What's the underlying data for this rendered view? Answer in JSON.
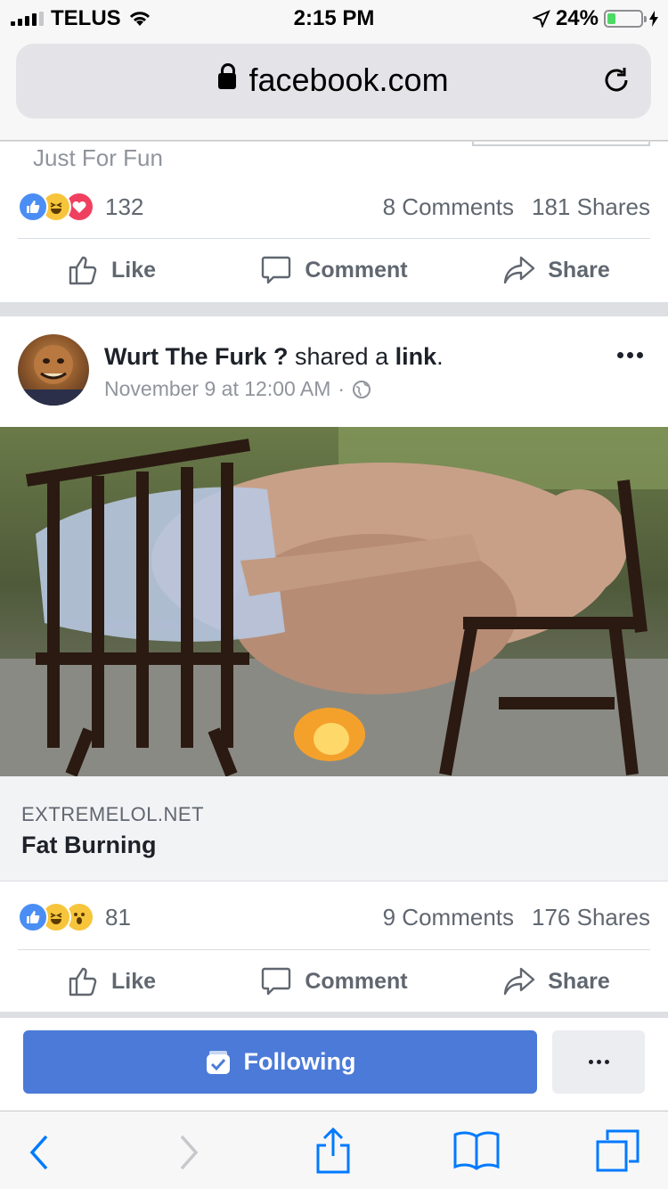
{
  "status": {
    "carrier": "TELUS",
    "time": "2:15 PM",
    "battery": "24%",
    "battery_level": 0.24
  },
  "browser": {
    "url": "facebook.com"
  },
  "post1": {
    "subtitle": "Just For Fun",
    "reaction_count": "132",
    "comments": "8 Comments",
    "shares": "181 Shares",
    "reactions": [
      "like-icon",
      "haha-icon",
      "love-icon"
    ],
    "actions": {
      "like": "Like",
      "comment": "Comment",
      "share": "Share"
    }
  },
  "post2": {
    "poster": "Wurt The Furk ?",
    "action_text": "shared a",
    "link_word": "link",
    "period": ".",
    "timestamp": "November 9 at 12:00 AM",
    "separator": "·",
    "link_domain": "EXTREMELOL.NET",
    "link_title": "Fat Burning",
    "reaction_count": "81",
    "comments": "9 Comments",
    "shares": "176 Shares",
    "reactions": [
      "like-icon",
      "haha-icon",
      "wow-icon"
    ],
    "actions": {
      "like": "Like",
      "comment": "Comment",
      "share": "Share"
    }
  },
  "follow": {
    "label": "Following"
  },
  "colors": {
    "brand": "#4b7ad8",
    "like": "#4a8ef5",
    "love": "#f0405f",
    "haha": "#f7c53b",
    "battery": "#4cd964"
  }
}
